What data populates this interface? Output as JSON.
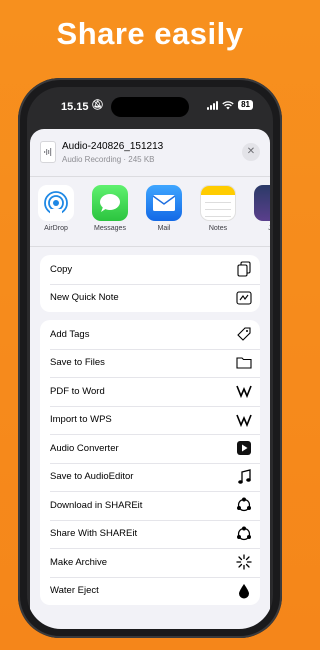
{
  "headline": "Share easily",
  "status": {
    "time": "15.15",
    "battery": "81"
  },
  "file": {
    "name": "Audio-240826_151213",
    "details": "Audio Recording · 245 KB"
  },
  "apps": [
    {
      "label": "AirDrop",
      "icon": "airdrop-icon"
    },
    {
      "label": "Messages",
      "icon": "messages-icon"
    },
    {
      "label": "Mail",
      "icon": "mail-icon"
    },
    {
      "label": "Notes",
      "icon": "notes-icon"
    },
    {
      "label": "Jo",
      "icon": "app-icon"
    }
  ],
  "group1": [
    {
      "label": "Copy",
      "icon": "copy-icon"
    },
    {
      "label": "New Quick Note",
      "icon": "quick-note-icon"
    }
  ],
  "group2": [
    {
      "label": "Add Tags",
      "icon": "tag-icon"
    },
    {
      "label": "Save to Files",
      "icon": "folder-icon"
    },
    {
      "label": "PDF to Word",
      "icon": "wps-icon"
    },
    {
      "label": "Import to WPS",
      "icon": "wps-icon"
    },
    {
      "label": "Audio Converter",
      "icon": "audio-converter-icon"
    },
    {
      "label": "Save to AudioEditor",
      "icon": "music-note-icon"
    },
    {
      "label": "Download in SHAREit",
      "icon": "shareit-icon"
    },
    {
      "label": "Share With SHAREit",
      "icon": "shareit-icon"
    },
    {
      "label": "Make Archive",
      "icon": "archive-icon"
    },
    {
      "label": "Water Eject",
      "icon": "water-drop-icon"
    }
  ]
}
